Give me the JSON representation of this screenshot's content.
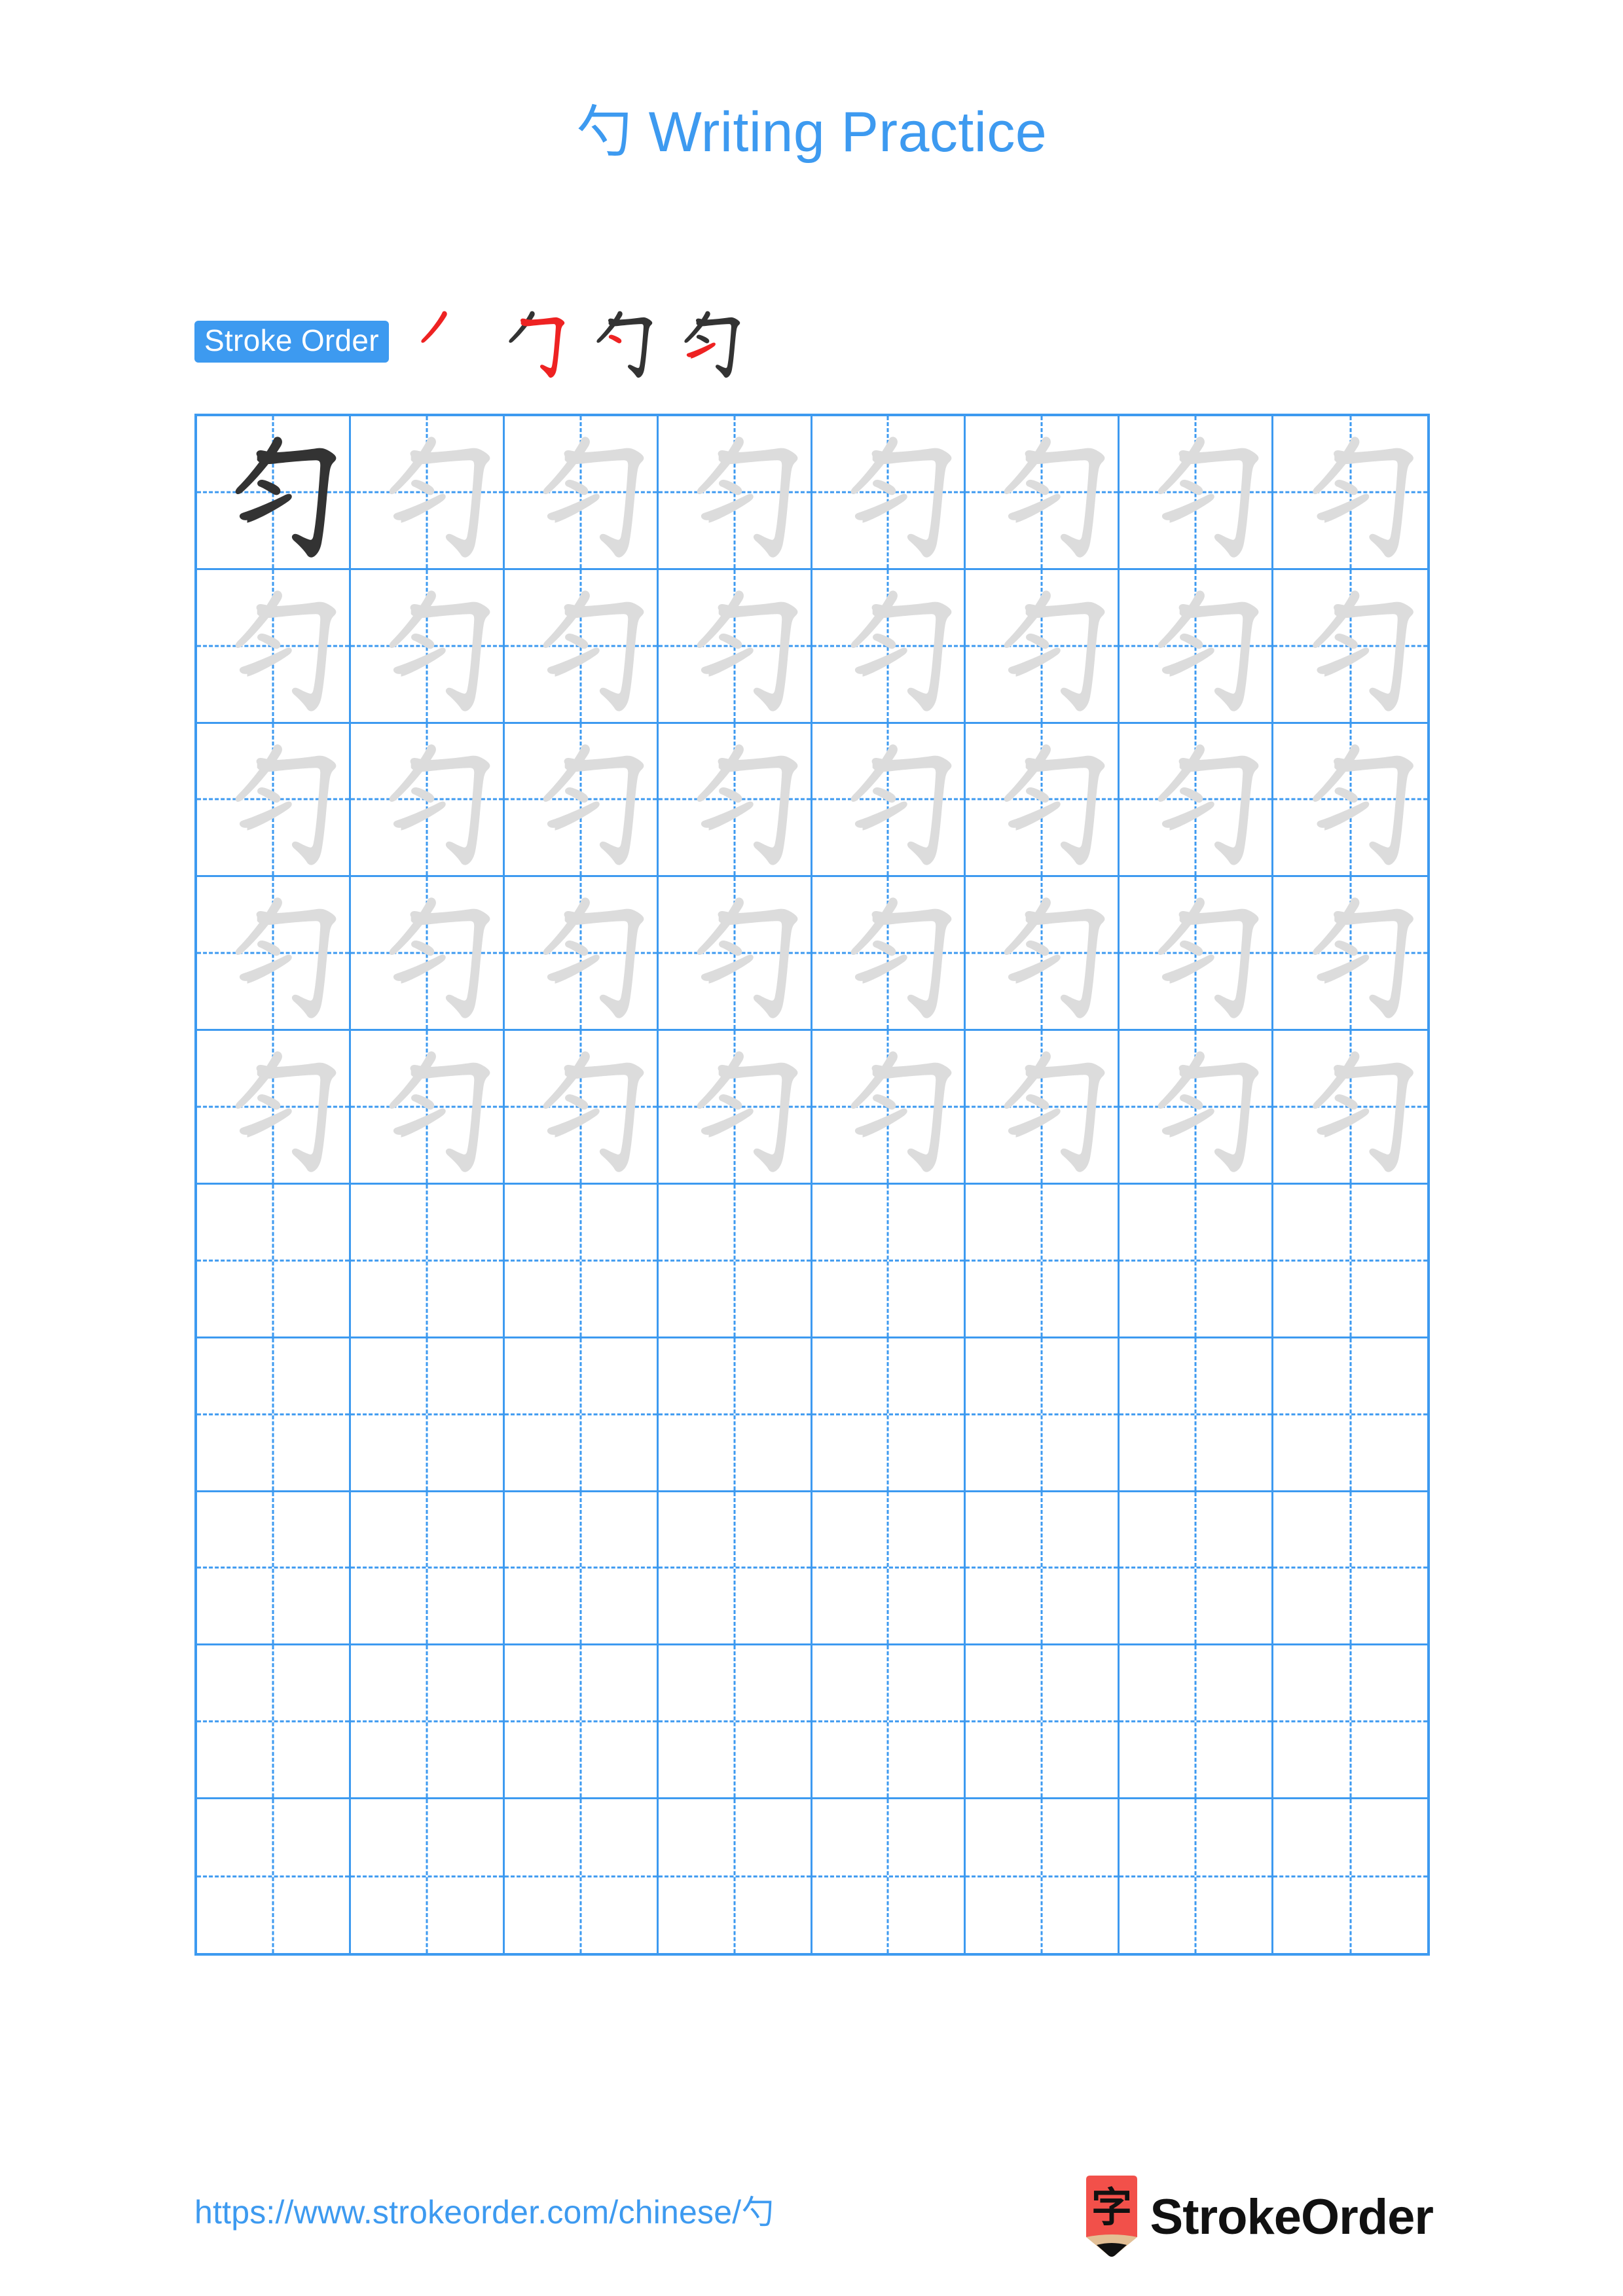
{
  "page": {
    "character": "勺",
    "title_suffix": " Writing Practice",
    "background_color": "#ffffff",
    "accent_color": "#3d9af0",
    "trace_color": "#dcdcdc",
    "ink_color": "#333333",
    "highlight_stroke_color": "#ee2222"
  },
  "stroke_order": {
    "badge_label": "Stroke Order",
    "steps": [
      {
        "index": 1,
        "new_stroke": "丿",
        "cumulative": "丿"
      },
      {
        "index": 2,
        "new_stroke": "𠃌",
        "cumulative": "勹"
      },
      {
        "index": 3,
        "new_stroke": "丶",
        "cumulative": "勺"
      },
      {
        "index": 4,
        "new_stroke": "一",
        "cumulative": "勺"
      }
    ],
    "total_strokes": 4
  },
  "practice_grid": {
    "columns": 8,
    "rows": 10,
    "grid_style": "tian-zi-ge",
    "guide_lines": "dashed-cross",
    "cells": [
      [
        "dark",
        "trace",
        "trace",
        "trace",
        "trace",
        "trace",
        "trace",
        "trace"
      ],
      [
        "trace",
        "trace",
        "trace",
        "trace",
        "trace",
        "trace",
        "trace",
        "trace"
      ],
      [
        "trace",
        "trace",
        "trace",
        "trace",
        "trace",
        "trace",
        "trace",
        "trace"
      ],
      [
        "trace",
        "trace",
        "trace",
        "trace",
        "trace",
        "trace",
        "trace",
        "trace"
      ],
      [
        "trace",
        "trace",
        "trace",
        "trace",
        "trace",
        "trace",
        "trace",
        "trace"
      ],
      [
        "empty",
        "empty",
        "empty",
        "empty",
        "empty",
        "empty",
        "empty",
        "empty"
      ],
      [
        "empty",
        "empty",
        "empty",
        "empty",
        "empty",
        "empty",
        "empty",
        "empty"
      ],
      [
        "empty",
        "empty",
        "empty",
        "empty",
        "empty",
        "empty",
        "empty",
        "empty"
      ],
      [
        "empty",
        "empty",
        "empty",
        "empty",
        "empty",
        "empty",
        "empty",
        "empty"
      ],
      [
        "empty",
        "empty",
        "empty",
        "empty",
        "empty",
        "empty",
        "empty",
        "empty"
      ]
    ]
  },
  "footer": {
    "url_prefix": "https://www.strokeorder.com/chinese/",
    "url_character": "勺",
    "brand_name": "StrokeOrder",
    "logo_character": "字",
    "logo_body_color": "#f2504a",
    "logo_wood_color": "#e3bf95",
    "logo_tip_color": "#111111"
  }
}
